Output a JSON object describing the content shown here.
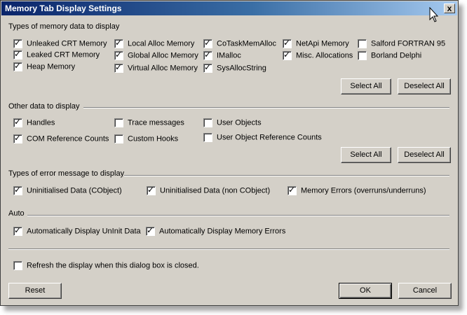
{
  "dialog": {
    "title": "Memory Tab Display Settings",
    "close_label": "x"
  },
  "memory_types": {
    "heading": "Types of memory data to display",
    "items": [
      {
        "label": "Unleaked CRT Memory",
        "checked": true
      },
      {
        "label": "Leaked CRT Memory",
        "checked": true
      },
      {
        "label": "Heap Memory",
        "checked": true
      },
      {
        "label": "Local Alloc Memory",
        "checked": true
      },
      {
        "label": "Global Alloc Memory",
        "checked": true
      },
      {
        "label": "Virtual Alloc Memory",
        "checked": true
      },
      {
        "label": "CoTaskMemAlloc",
        "checked": true
      },
      {
        "label": "IMalloc",
        "checked": true
      },
      {
        "label": "SysAllocString",
        "checked": true
      },
      {
        "label": "NetApi Memory",
        "checked": true
      },
      {
        "label": "Misc. Allocations",
        "checked": true
      },
      {
        "label": "Salford FORTRAN 95",
        "checked": false
      },
      {
        "label": "Borland Delphi",
        "checked": false
      }
    ],
    "select_all": "Select All",
    "deselect_all": "Deselect All"
  },
  "other_data": {
    "heading": "Other data to display",
    "items": [
      {
        "label": "Handles",
        "checked": true
      },
      {
        "label": "COM Reference Counts",
        "checked": true
      },
      {
        "label": "Trace messages",
        "checked": false
      },
      {
        "label": "Custom Hooks",
        "checked": false
      },
      {
        "label": "User Objects",
        "checked": false
      },
      {
        "label": "User Object Reference Counts",
        "checked": false
      }
    ],
    "select_all": "Select All",
    "deselect_all": "Deselect All"
  },
  "error_types": {
    "heading": "Types of error message to display",
    "items": [
      {
        "label": "Uninitialised Data (CObject)",
        "checked": true
      },
      {
        "label": "Uninitialised Data (non CObject)",
        "checked": true
      },
      {
        "label": "Memory Errors (overruns/underruns)",
        "checked": true
      }
    ]
  },
  "auto": {
    "heading": "Auto",
    "items": [
      {
        "label": "Automatically Display UnInit Data",
        "checked": true
      },
      {
        "label": "Automatically Display Memory Errors",
        "checked": true
      }
    ]
  },
  "refresh": {
    "label": "Refresh the display when this dialog box is closed.",
    "checked": false
  },
  "buttons": {
    "reset": "Reset",
    "ok": "OK",
    "cancel": "Cancel"
  }
}
